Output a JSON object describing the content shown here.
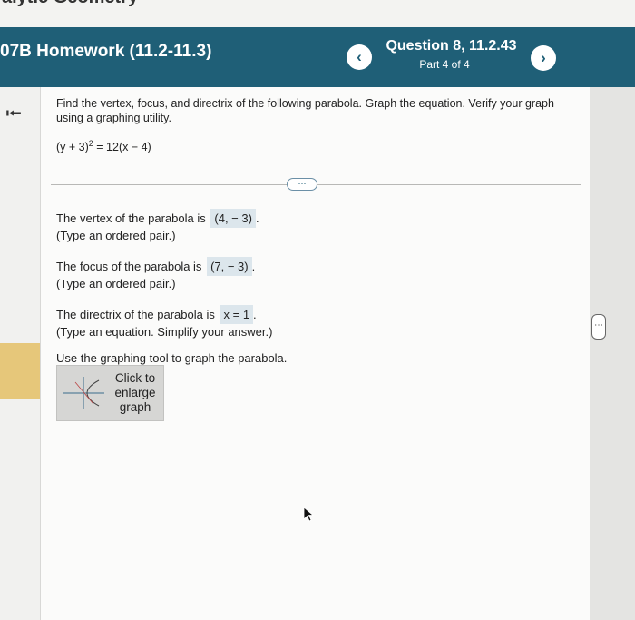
{
  "page_top_partial": "alytic Geometry",
  "header": {
    "assignment_title": "07B Homework (11.2-11.3)",
    "question_title": "Question 8, 11.2.43",
    "part_text": "Part 4 of 4",
    "prev_symbol": "‹",
    "next_symbol": "›",
    "color": "#1f5f77"
  },
  "sidebar": {
    "back_icon": "⭰"
  },
  "question": {
    "text": "Find the vertex, focus, and directrix of the following parabola. Graph the equation. Verify your graph using a graphing utility.",
    "equation_lhs": "(y + 3)",
    "equation_exp": "2",
    "equation_rhs": " = 12(x − 4)"
  },
  "more_label": "⋯",
  "answers": {
    "vertex_prefix": "The vertex of the parabola is",
    "vertex_value": "(4, − 3)",
    "vertex_hint": "(Type an ordered pair.)",
    "focus_prefix": "The focus of the parabola is",
    "focus_value": "(7,  − 3)",
    "focus_hint": "(Type an ordered pair.)",
    "directrix_prefix": "The directrix of the parabola is",
    "directrix_value": "x = 1",
    "directrix_hint": "(Type an equation. Simplify your answer.)",
    "graph_instruction": "Use the graphing tool to graph the parabola."
  },
  "graph_button": {
    "label": "Click to enlarge graph"
  }
}
